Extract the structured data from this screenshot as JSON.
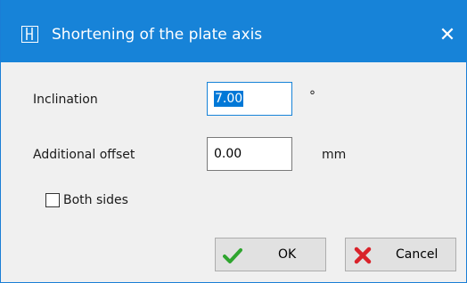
{
  "window": {
    "title": "Shortening of the plate axis",
    "close_glyph": "✕"
  },
  "fields": {
    "inclination": {
      "label": "Inclination",
      "value": "7.00",
      "unit": "°"
    },
    "additional_offset": {
      "label": "Additional offset",
      "value": "0.00",
      "unit": "mm"
    }
  },
  "options": {
    "both_sides": {
      "label": "Both sides",
      "checked": false
    }
  },
  "buttons": {
    "ok": {
      "label": "OK",
      "icon": "checkmark-icon"
    },
    "cancel": {
      "label": "Cancel",
      "icon": "cross-icon"
    }
  },
  "colors": {
    "titlebar": "#1783d8",
    "ok_icon": "#2fa52f",
    "cancel_icon": "#d9222a"
  }
}
